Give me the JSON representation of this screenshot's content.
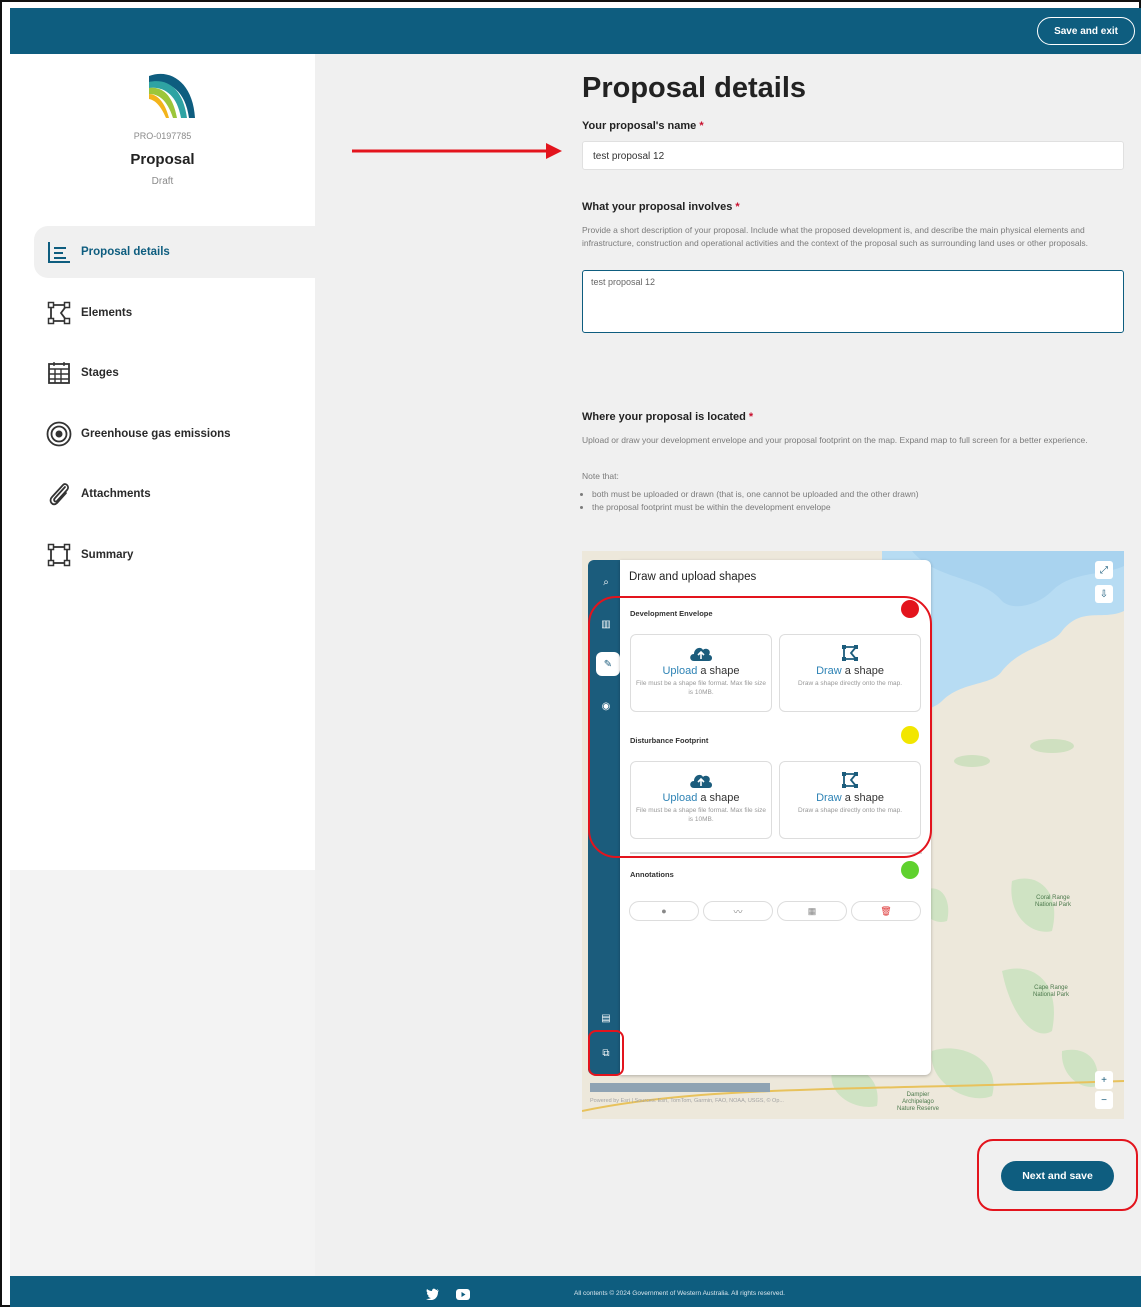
{
  "header": {
    "save_exit_label": "Save and exit"
  },
  "proposal": {
    "id": "PRO-0197785",
    "title": "Proposal",
    "status": "Draft"
  },
  "sidebar": {
    "items": [
      {
        "label": "Proposal details",
        "icon": "list-chart-icon"
      },
      {
        "label": "Elements",
        "icon": "polygon-icon"
      },
      {
        "label": "Stages",
        "icon": "calendar-icon"
      },
      {
        "label": "Greenhouse gas emissions",
        "icon": "target-icon"
      },
      {
        "label": "Attachments",
        "icon": "paperclip-icon"
      },
      {
        "label": "Summary",
        "icon": "square-nodes-icon"
      }
    ]
  },
  "main": {
    "title": "Proposal details",
    "name_field": {
      "label": "Your proposal's name",
      "required": "*",
      "value": "test proposal 12"
    },
    "involves_field": {
      "label": "What your proposal involves",
      "required": "*",
      "help": "Provide a short description of your proposal. Include what the proposed development is, and describe the main physical elements and infrastructure, construction and operational activities and the context of the proposal such as surrounding land uses or other proposals.",
      "value": "test proposal 12"
    },
    "location": {
      "label": "Where your proposal is located",
      "required": "*",
      "help": "Upload or draw your development envelope and your proposal footprint on the map. Expand map to full screen for a better experience.",
      "note": "Note that:",
      "bullets": [
        "both must be uploaded or drawn (that is, one cannot be uploaded and the other drawn)",
        "the proposal footprint must be within the development envelope"
      ]
    },
    "next_label": "Next and save"
  },
  "map_panel": {
    "title": "Draw and upload shapes",
    "sections": [
      {
        "name": "Development Envelope",
        "color": "#e3141d",
        "upload": {
          "link": "Upload",
          "rest": " a shape",
          "hint": "File must be a shape file format. Max file size is 10MB."
        },
        "draw": {
          "link": "Draw",
          "rest": " a shape",
          "hint": "Draw a shape directly onto the map."
        }
      },
      {
        "name": "Disturbance Footprint",
        "color": "#f2e600",
        "upload": {
          "link": "Upload",
          "rest": " a shape",
          "hint": "File must be a shape file format. Max file size is 10MB."
        },
        "draw": {
          "link": "Draw",
          "rest": " a shape",
          "hint": "Draw a shape directly onto the map."
        }
      }
    ],
    "annotations": {
      "label": "Annotations",
      "color": "#5fd12e"
    },
    "map_labels": [
      "Coral Range National Park",
      "Cape Range National Park",
      "Dampier Archipelago Nature Reserve"
    ],
    "credit": "Powered by Esri | Sources: Esri, TomTom, Garmin, FAO, NOAA, USGS, © Op..."
  },
  "footer": {
    "copyright": "All contents © 2024 Government of Western Australia. All rights reserved."
  }
}
